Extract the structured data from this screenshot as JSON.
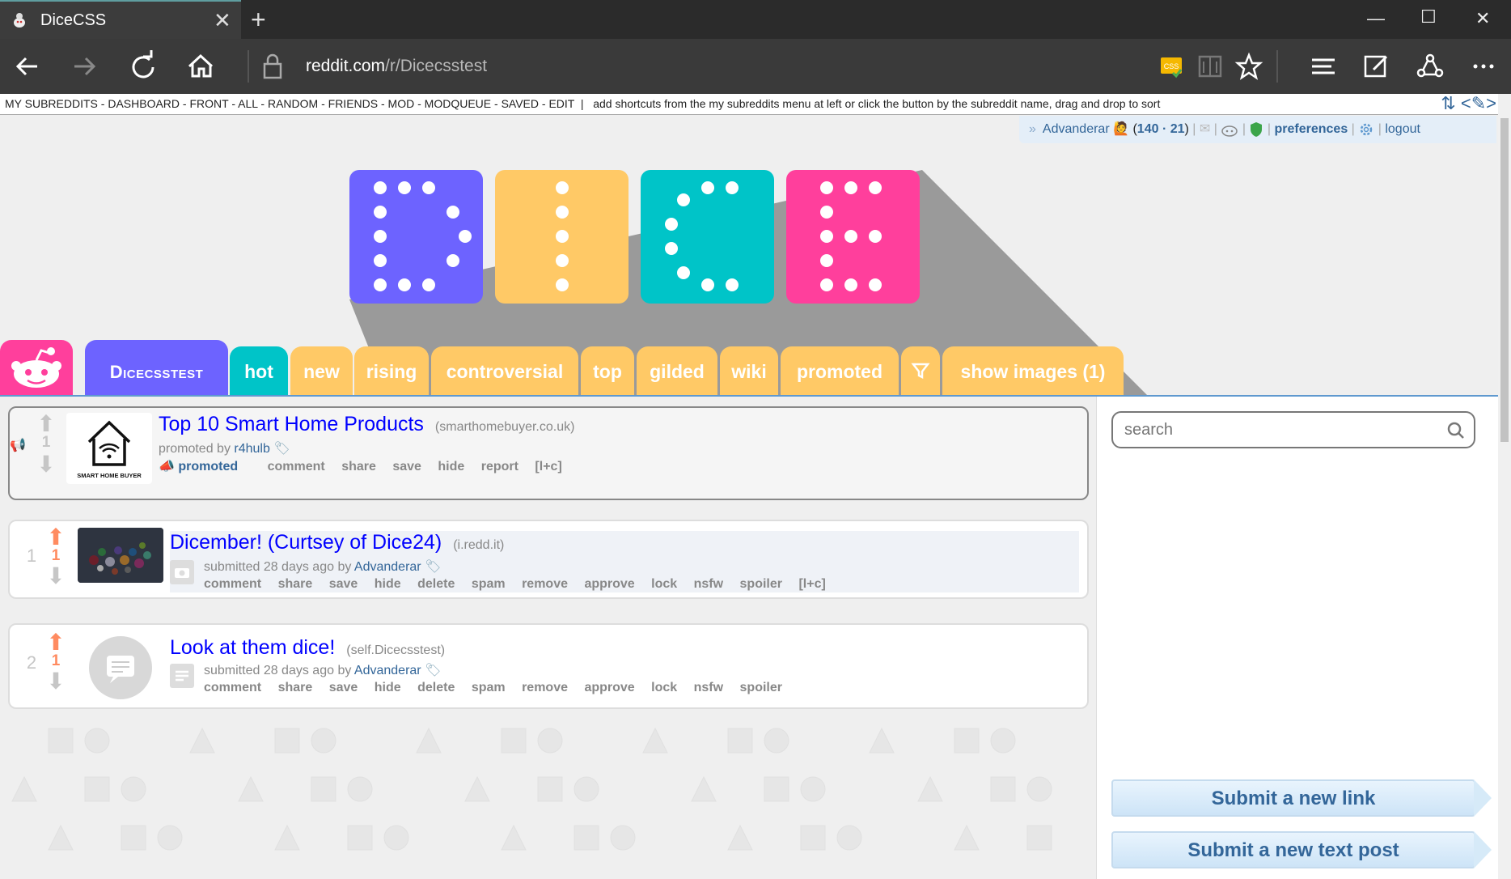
{
  "browser": {
    "tab_title": "DiceCSS",
    "address_host": "reddit.com",
    "address_path": "/r/Dicecsstest"
  },
  "srbar": {
    "links": [
      "MY SUBREDDITS",
      "DASHBOARD",
      "FRONT",
      "ALL",
      "RANDOM",
      "FRIENDS",
      "MOD",
      "MODQUEUE",
      "SAVED",
      "EDIT"
    ],
    "hint": "add shortcuts from the my subreddits menu at left or click the button by the subreddit name, drag and drop to sort"
  },
  "userbar": {
    "username": "Advanderar",
    "karma": "140 · 21",
    "preferences": "preferences",
    "logout": "logout"
  },
  "header": {
    "subreddit_name": "Dicecsstest",
    "tabs": [
      "hot",
      "new",
      "rising",
      "controversial",
      "top",
      "gilded",
      "wiki",
      "promoted",
      "show images (1)"
    ],
    "active_tab": "hot"
  },
  "posts": [
    {
      "rank": "",
      "score": "1",
      "title": "Top 10 Smart Home Products",
      "domain": "(smarthomebuyer.co.uk)",
      "tagline_prefix": "promoted by",
      "author": "r4hulb",
      "thumb_caption": "SMART HOME BUYER",
      "promoted_label": "promoted",
      "buttons": [
        "comment",
        "share",
        "save",
        "hide",
        "report",
        "[l+c]"
      ]
    },
    {
      "rank": "1",
      "score": "1",
      "title": "Dicember! (Curtsey of Dice24)",
      "domain": "(i.redd.it)",
      "tagline_prefix": "submitted 28 days ago by",
      "author": "Advanderar",
      "buttons": [
        "comment",
        "share",
        "save",
        "hide",
        "delete",
        "spam",
        "remove",
        "approve",
        "lock",
        "nsfw",
        "spoiler",
        "[l+c]"
      ]
    },
    {
      "rank": "2",
      "score": "1",
      "title": "Look at them dice!",
      "domain": "(self.Dicecsstest)",
      "tagline_prefix": "submitted 28 days ago by",
      "author": "Advanderar",
      "buttons": [
        "comment",
        "share",
        "save",
        "hide",
        "delete",
        "spam",
        "remove",
        "approve",
        "lock",
        "nsfw",
        "spoiler"
      ]
    }
  ],
  "sidebar": {
    "search_placeholder": "search",
    "submit_link": "Submit a new link",
    "submit_text": "Submit a new text post"
  },
  "colors": {
    "die_d": "#6d63ff",
    "die_i": "#ffc966",
    "die_c": "#00c4c8",
    "die_e": "#ff3f9c",
    "upvote": "#ff8b60",
    "link": "#0000ff"
  },
  "icons": [
    "back-icon",
    "forward-icon",
    "refresh-icon",
    "home-icon",
    "lock-icon",
    "css-extension-icon",
    "reading-view-icon",
    "favorite-star-icon",
    "hub-icon",
    "web-note-icon",
    "share-icon",
    "more-icon",
    "mail-icon",
    "modmail-icon",
    "shield-icon",
    "gear-icon",
    "search-icon",
    "filter-icon",
    "reddit-alien-icon"
  ]
}
